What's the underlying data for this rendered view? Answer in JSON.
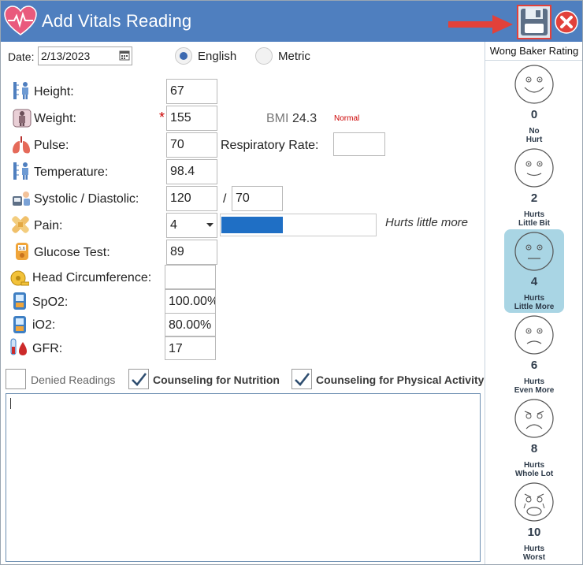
{
  "window": {
    "title": "Add Vitals Reading"
  },
  "toolbar": {
    "save_icon": "floppy-disk-icon",
    "close_icon": "close-circle-icon",
    "arrow_color": "#e2413a"
  },
  "date": {
    "label": "Date:",
    "value": "2/13/2023"
  },
  "units": {
    "options": [
      "English",
      "Metric"
    ],
    "selected": "English"
  },
  "vitals": {
    "height": {
      "label": "Height:",
      "value": "67"
    },
    "weight": {
      "label": "Weight:",
      "value": "155",
      "required_mark": "*"
    },
    "bmi": {
      "label": "BMI",
      "value": "24.3",
      "status": "Normal"
    },
    "pulse": {
      "label": "Pulse:",
      "value": "70"
    },
    "respiratory_rate": {
      "label": "Respiratory Rate:",
      "value": ""
    },
    "temperature": {
      "label": "Temperature:",
      "value": "98.4"
    },
    "bp": {
      "label": "Systolic / Diastolic:",
      "systolic": "120",
      "separator": "/",
      "diastolic": "70"
    },
    "pain": {
      "label": "Pain:",
      "value": "4",
      "level": 0.4,
      "description": "Hurts little more"
    },
    "glucose": {
      "label": "Glucose Test:",
      "value": "89"
    },
    "head_circumference": {
      "label": "Head Circumference:",
      "value": ""
    },
    "spo2": {
      "label": "SpO2:",
      "value": "100.00%"
    },
    "io2": {
      "label": "iO2:",
      "value": "80.00%"
    },
    "gfr": {
      "label": "GFR:",
      "value": "17"
    }
  },
  "checkboxes": [
    {
      "label": "Denied Readings",
      "checked": false
    },
    {
      "label": "Counseling for Nutrition",
      "checked": true
    },
    {
      "label": "Counseling for Physical Activity",
      "checked": true
    }
  ],
  "notes": {
    "value": ""
  },
  "wong_baker": {
    "title": "Wong Baker Rating",
    "selected": "4",
    "faces": [
      {
        "score": "0",
        "caption1": "No",
        "caption2": "Hurt"
      },
      {
        "score": "2",
        "caption1": "Hurts",
        "caption2": "Little Bit"
      },
      {
        "score": "4",
        "caption1": "Hurts",
        "caption2": "Little More"
      },
      {
        "score": "6",
        "caption1": "Hurts",
        "caption2": "Even More"
      },
      {
        "score": "8",
        "caption1": "Hurts",
        "caption2": "Whole Lot"
      },
      {
        "score": "10",
        "caption1": "Hurts",
        "caption2": "Worst"
      }
    ]
  },
  "colors": {
    "titlebar": "#4f7fbf",
    "pain_bar": "#1f6fc5",
    "selected_face": "#a9d5e4",
    "bmi_status": "#cc0000"
  }
}
